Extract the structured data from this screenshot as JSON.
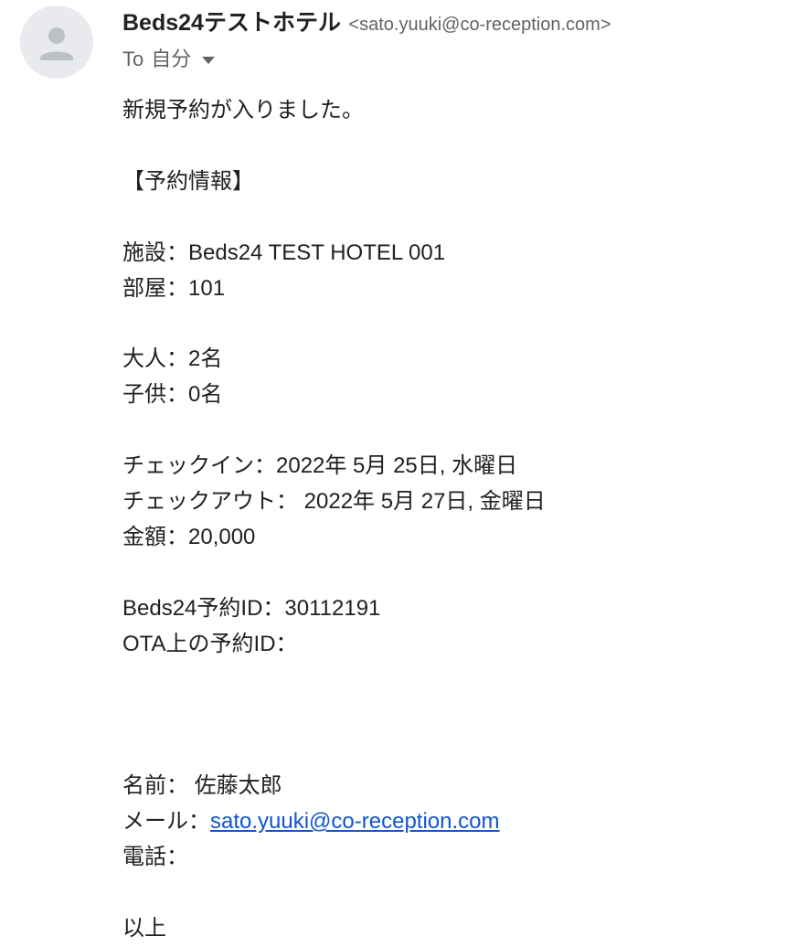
{
  "sender": {
    "name": "Beds24テストホテル",
    "email": "<sato.yuuki@co-reception.com>"
  },
  "recipient": {
    "to_label": "To",
    "to_value": "自分"
  },
  "message": {
    "intro": "新規予約が入りました。",
    "section_title": "【予約情報】",
    "facility_label": "施設：",
    "facility_value": "Beds24 TEST HOTEL 001",
    "room_label": "部屋：",
    "room_value": "101",
    "adults_label": "大人：",
    "adults_value": "2名",
    "children_label": "子供：",
    "children_value": "0名",
    "checkin_label": "チェックイン：",
    "checkin_value": "2022年 5月 25日, 水曜日",
    "checkout_label": "チェックアウト：",
    "checkout_value": " 2022年 5月 27日, 金曜日",
    "amount_label": "金額：",
    "amount_value": "20,000",
    "beds24_id_label": "Beds24予約ID：",
    "beds24_id_value": "30112191",
    "ota_id_label": "OTA上の予約ID：",
    "ota_id_value": "",
    "name_label": "名前：",
    "name_value": " 佐藤太郎",
    "mail_label": "メール：",
    "mail_value": "sato.yuuki@co-reception.com",
    "phone_label": "電話：",
    "phone_value": "",
    "closing": "以上"
  },
  "colors": {
    "link": "#1155cc",
    "secondary_text": "#5f6368",
    "primary_text": "#202124",
    "avatar_bg": "#e8eaed"
  },
  "icons": {
    "avatar": "person-icon",
    "to_dropdown": "chevron-down-icon"
  }
}
